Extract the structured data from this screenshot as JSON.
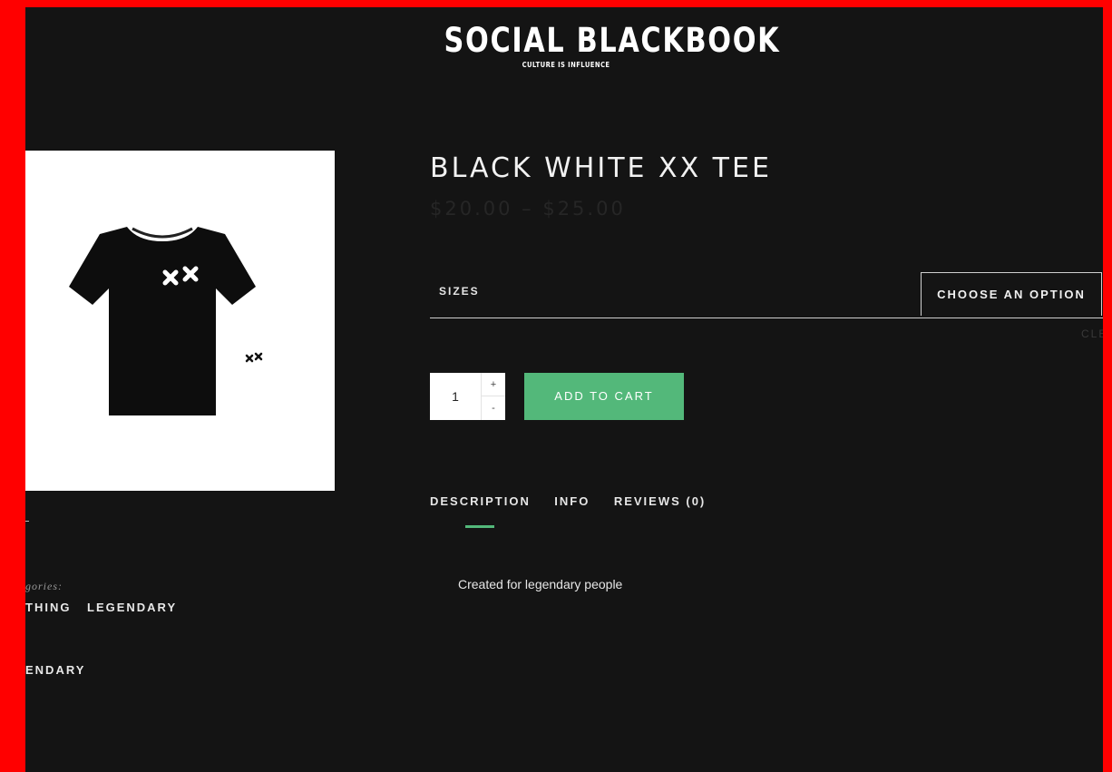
{
  "brand": {
    "title": "SOCIAL BLACKBOOK",
    "tagline": "CULTURE IS INFLUENCE"
  },
  "product": {
    "title": "BLACK WHITE XX TEE",
    "price_range": "$20.00 – $25.00",
    "image_alt_mark": "xx"
  },
  "variations": {
    "label": "SIZES",
    "select_value": "CHOOSE AN OPTION",
    "clear_label": "CLE"
  },
  "cart": {
    "quantity": "1",
    "plus_label": "+",
    "minus_label": "-",
    "add_to_cart_label": "ADD TO CART"
  },
  "tabs": [
    {
      "label": "DESCRIPTION",
      "active": true
    },
    {
      "label": "INFO",
      "active": false
    },
    {
      "label": "REVIEWS (0)",
      "active": false
    }
  ],
  "description": {
    "text": "Created for legendary people"
  },
  "meta": {
    "categories_label": "gories:",
    "categories": [
      "THING",
      "LEGENDARY"
    ],
    "tags": [
      "ENDARY"
    ]
  },
  "colors": {
    "background_border": "#ff0000",
    "page_background": "#141414",
    "accent_green": "#53b87a",
    "price_text": "#262626"
  }
}
